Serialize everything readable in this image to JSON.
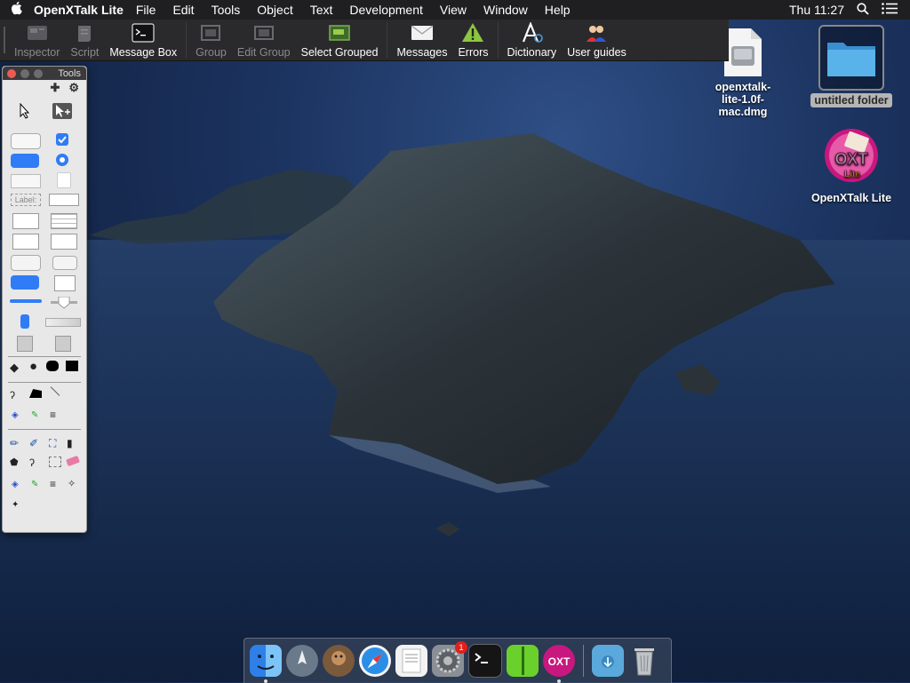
{
  "menubar": {
    "apple": "",
    "app_name": "OpenXTalk Lite",
    "items": [
      "File",
      "Edit",
      "Tools",
      "Object",
      "Text",
      "Development",
      "View",
      "Window",
      "Help"
    ],
    "clock": "Thu 11:27"
  },
  "toolbar": {
    "buttons": [
      {
        "label": "Inspector",
        "icon": "inspector-icon",
        "enabled": false
      },
      {
        "label": "Script",
        "icon": "script-icon",
        "enabled": false
      },
      {
        "label": "Message Box",
        "icon": "message-box-icon",
        "enabled": true
      },
      {
        "label": "Group",
        "icon": "group-icon",
        "enabled": false
      },
      {
        "label": "Edit Group",
        "icon": "edit-group-icon",
        "enabled": false
      },
      {
        "label": "Select Grouped",
        "icon": "select-grouped-icon",
        "enabled": true
      },
      {
        "label": "Messages",
        "icon": "messages-icon",
        "enabled": true
      },
      {
        "label": "Errors",
        "icon": "errors-icon",
        "enabled": true
      },
      {
        "label": "Dictionary",
        "icon": "dictionary-icon",
        "enabled": true
      },
      {
        "label": "User guides",
        "icon": "user-guides-icon",
        "enabled": true
      }
    ]
  },
  "palette": {
    "title": "Tools",
    "field_label": "Label:"
  },
  "desktop": {
    "dmg_label_line1": "openxtalk-",
    "dmg_label_line2": "lite-1.0f-mac.dmg",
    "folder_label": "untitled folder",
    "app_label": "OpenXTalk Lite",
    "app_logo_text": "OXT",
    "app_logo_sub": "Lite"
  },
  "dock": {
    "items": [
      "finder",
      "launchpad",
      "sequel",
      "safari",
      "textedit",
      "system-preferences",
      "terminal",
      "archive",
      "openxtalk",
      "downloads",
      "trash"
    ],
    "prefs_badge": "1",
    "oxt_logo_text": "OXT"
  },
  "colors": {
    "accent": "#2f7cf6",
    "menubar": "#1f1f22",
    "toolbar": "#2a2a2d",
    "palette_bg": "#e8e8e8",
    "folder": "#4ea6e0",
    "oxt_pink": "#c8177e"
  }
}
